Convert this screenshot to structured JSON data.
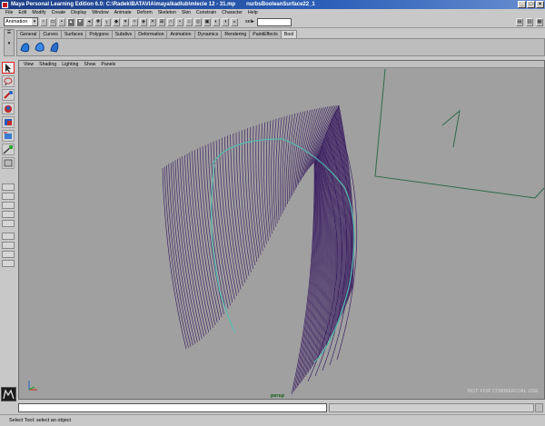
{
  "window": {
    "title": "Maya Personal Learning Edition 6.0: C:\\Radek\\BATAVIA\\maya\\kadlub\\mlecie 12 - 31.mp",
    "extra": "nurbsBooleanSurface22_1"
  },
  "menubar": [
    "File",
    "Edit",
    "Modify",
    "Create",
    "Display",
    "Window",
    "Animate",
    "Deform",
    "Skeleton",
    "Skin",
    "Constrain",
    "Character",
    "Help"
  ],
  "statusline": {
    "mode": "Animation",
    "selection_label": "sel▸",
    "selection_value": ""
  },
  "shelf": {
    "tabs": [
      "General",
      "Curves",
      "Surfaces",
      "Polygons",
      "Subdivs",
      "Deformation",
      "Animation",
      "Dynamics",
      "Rendering",
      "PaintEffects",
      "Bool"
    ],
    "active_tab": "Bool"
  },
  "viewport": {
    "panel_menu": [
      "View",
      "Shading",
      "Lighting",
      "Show",
      "Panels"
    ],
    "camera": "persp",
    "watermark": "NOT FOR COMMERCIAL USE"
  },
  "helpline": {
    "text": "Select Tool: select an object"
  },
  "colors": {
    "wire": "#3a1e60",
    "highlight": "#50c0b0",
    "viewport_bg": "#a0a0a0",
    "camera_green": "#2e6a4a"
  }
}
